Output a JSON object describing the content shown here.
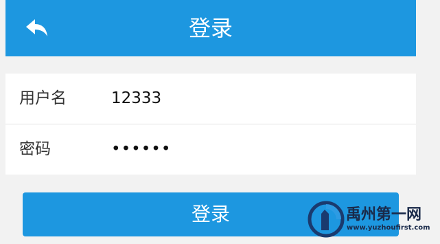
{
  "header": {
    "title": "登录",
    "back_icon": "back-arrow-icon"
  },
  "form": {
    "username": {
      "label": "用户名",
      "value": "12333"
    },
    "password": {
      "label": "密码",
      "value": "••••••"
    }
  },
  "login_button": {
    "label": "登录"
  },
  "watermark": {
    "name": "禹州第一网",
    "url": "www.yuzhoufirst.com"
  },
  "colors": {
    "accent": "#1d97e0",
    "background": "#f2f2f2",
    "card": "#ffffff"
  }
}
